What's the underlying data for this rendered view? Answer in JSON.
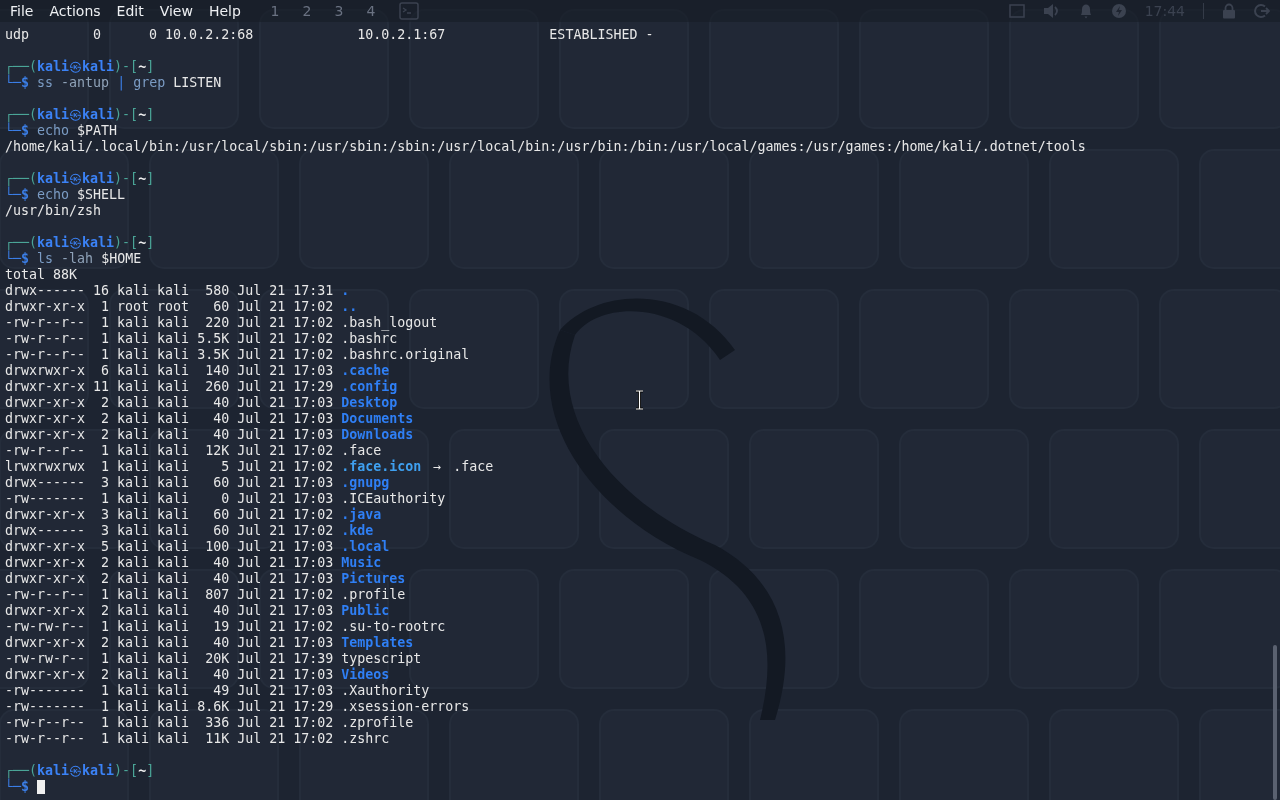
{
  "menu": [
    {
      "label": "File"
    },
    {
      "label": "Actions"
    },
    {
      "label": "Edit"
    },
    {
      "label": "View"
    },
    {
      "label": "Help"
    }
  ],
  "panel": {
    "workspaces": [
      "1",
      "2",
      "3",
      "4"
    ],
    "clock": "17:44"
  },
  "lines": [
    {
      "kind": "output",
      "text": "udp        0      0 10.0.2.2:68             10.0.2.1:67             ESTABLISHED -"
    },
    {
      "kind": "blank"
    },
    {
      "kind": "prompt",
      "open": "┌──(",
      "user": "kali",
      "at": "㉿",
      "host": "kali",
      "mid": ")-[",
      "dir": "~",
      "close": "]"
    },
    {
      "kind": "command",
      "lead": "└─$",
      "tokens": [
        {
          "text": "ss",
          "kind": "program"
        },
        {
          "text": "-antup",
          "kind": "option"
        },
        {
          "text": "|",
          "kind": "pipe"
        },
        {
          "text": "grep",
          "kind": "program"
        },
        {
          "text": "LISTEN",
          "kind": "arg"
        }
      ],
      "cursor": false
    },
    {
      "kind": "blank"
    },
    {
      "kind": "prompt",
      "open": "┌──(",
      "user": "kali",
      "at": "㉿",
      "host": "kali",
      "mid": ")-[",
      "dir": "~",
      "close": "]"
    },
    {
      "kind": "command",
      "lead": "└─$",
      "tokens": [
        {
          "text": "echo",
          "kind": "program"
        },
        {
          "text": "$PATH",
          "kind": "arg"
        }
      ],
      "cursor": false
    },
    {
      "kind": "output",
      "text": "/home/kali/.local/bin:/usr/local/sbin:/usr/sbin:/sbin:/usr/local/bin:/usr/bin:/bin:/usr/local/games:/usr/games:/home/kali/.dotnet/tools"
    },
    {
      "kind": "blank"
    },
    {
      "kind": "prompt",
      "open": "┌──(",
      "user": "kali",
      "at": "㉿",
      "host": "kali",
      "mid": ")-[",
      "dir": "~",
      "close": "]"
    },
    {
      "kind": "command",
      "lead": "└─$",
      "tokens": [
        {
          "text": "echo",
          "kind": "program"
        },
        {
          "text": "$SHELL",
          "kind": "arg"
        }
      ],
      "cursor": false
    },
    {
      "kind": "output",
      "text": "/usr/bin/zsh"
    },
    {
      "kind": "blank"
    },
    {
      "kind": "prompt",
      "open": "┌──(",
      "user": "kali",
      "at": "㉿",
      "host": "kali",
      "mid": ")-[",
      "dir": "~",
      "close": "]"
    },
    {
      "kind": "command",
      "lead": "└─$",
      "tokens": [
        {
          "text": "ls",
          "kind": "program"
        },
        {
          "text": "-lah",
          "kind": "option"
        },
        {
          "text": "$HOME",
          "kind": "arg"
        }
      ],
      "cursor": false
    },
    {
      "kind": "output",
      "text": "total 88K"
    },
    {
      "kind": "directory",
      "meta": "drwx------ 16 kali kali  580 Jul 21 17:31",
      "name": "."
    },
    {
      "kind": "directory",
      "meta": "drwxr-xr-x  1 root root   60 Jul 21 17:02",
      "name": ".."
    },
    {
      "kind": "file",
      "meta": "-rw-r--r--  1 kali kali  220 Jul 21 17:02",
      "name": ".bash_logout"
    },
    {
      "kind": "file",
      "meta": "-rw-r--r--  1 kali kali 5.5K Jul 21 17:02",
      "name": ".bashrc"
    },
    {
      "kind": "file",
      "meta": "-rw-r--r--  1 kali kali 3.5K Jul 21 17:02",
      "name": ".bashrc.original"
    },
    {
      "kind": "directory",
      "meta": "drwxrwxr-x  6 kali kali  140 Jul 21 17:03",
      "name": ".cache"
    },
    {
      "kind": "directory",
      "meta": "drwxr-xr-x 11 kali kali  260 Jul 21 17:29",
      "name": ".config"
    },
    {
      "kind": "directory",
      "meta": "drwxr-xr-x  2 kali kali   40 Jul 21 17:03",
      "name": "Desktop"
    },
    {
      "kind": "directory",
      "meta": "drwxr-xr-x  2 kali kali   40 Jul 21 17:03",
      "name": "Documents"
    },
    {
      "kind": "directory",
      "meta": "drwxr-xr-x  2 kali kali   40 Jul 21 17:03",
      "name": "Downloads"
    },
    {
      "kind": "file",
      "meta": "-rw-r--r--  1 kali kali  12K Jul 21 17:02",
      "name": ".face"
    },
    {
      "kind": "symlink",
      "meta": "lrwxrwxrwx  1 kali kali    5 Jul 21 17:02",
      "name": ".face.icon",
      "arrow": "→",
      "target": ".face"
    },
    {
      "kind": "directory",
      "meta": "drwx------  3 kali kali   60 Jul 21 17:03",
      "name": ".gnupg"
    },
    {
      "kind": "file",
      "meta": "-rw-------  1 kali kali    0 Jul 21 17:03",
      "name": ".ICEauthority"
    },
    {
      "kind": "directory",
      "meta": "drwxr-xr-x  3 kali kali   60 Jul 21 17:02",
      "name": ".java"
    },
    {
      "kind": "directory",
      "meta": "drwx------  3 kali kali   60 Jul 21 17:02",
      "name": ".kde"
    },
    {
      "kind": "directory",
      "meta": "drwxr-xr-x  5 kali kali  100 Jul 21 17:03",
      "name": ".local"
    },
    {
      "kind": "directory",
      "meta": "drwxr-xr-x  2 kali kali   40 Jul 21 17:03",
      "name": "Music"
    },
    {
      "kind": "directory",
      "meta": "drwxr-xr-x  2 kali kali   40 Jul 21 17:03",
      "name": "Pictures"
    },
    {
      "kind": "file",
      "meta": "-rw-r--r--  1 kali kali  807 Jul 21 17:02",
      "name": ".profile"
    },
    {
      "kind": "directory",
      "meta": "drwxr-xr-x  2 kali kali   40 Jul 21 17:03",
      "name": "Public"
    },
    {
      "kind": "file",
      "meta": "-rw-rw-r--  1 kali kali   19 Jul 21 17:02",
      "name": ".su-to-rootrc"
    },
    {
      "kind": "directory",
      "meta": "drwxr-xr-x  2 kali kali   40 Jul 21 17:03",
      "name": "Templates"
    },
    {
      "kind": "file",
      "meta": "-rw-rw-r--  1 kali kali  20K Jul 21 17:39",
      "name": "typescript"
    },
    {
      "kind": "directory",
      "meta": "drwxr-xr-x  2 kali kali   40 Jul 21 17:03",
      "name": "Videos"
    },
    {
      "kind": "file",
      "meta": "-rw-------  1 kali kali   49 Jul 21 17:03",
      "name": ".Xauthority"
    },
    {
      "kind": "file",
      "meta": "-rw-------  1 kali kali 8.6K Jul 21 17:29",
      "name": ".xsession-errors"
    },
    {
      "kind": "file",
      "meta": "-rw-r--r--  1 kali kali  336 Jul 21 17:02",
      "name": ".zprofile"
    },
    {
      "kind": "file",
      "meta": "-rw-r--r--  1 kali kali  11K Jul 21 17:02",
      "name": ".zshrc"
    },
    {
      "kind": "blank"
    },
    {
      "kind": "prompt",
      "open": "┌──(",
      "user": "kali",
      "at": "㉿",
      "host": "kali",
      "mid": ")-[",
      "dir": "~",
      "close": "]"
    },
    {
      "kind": "command",
      "lead": "└─$",
      "cursor": true
    }
  ]
}
